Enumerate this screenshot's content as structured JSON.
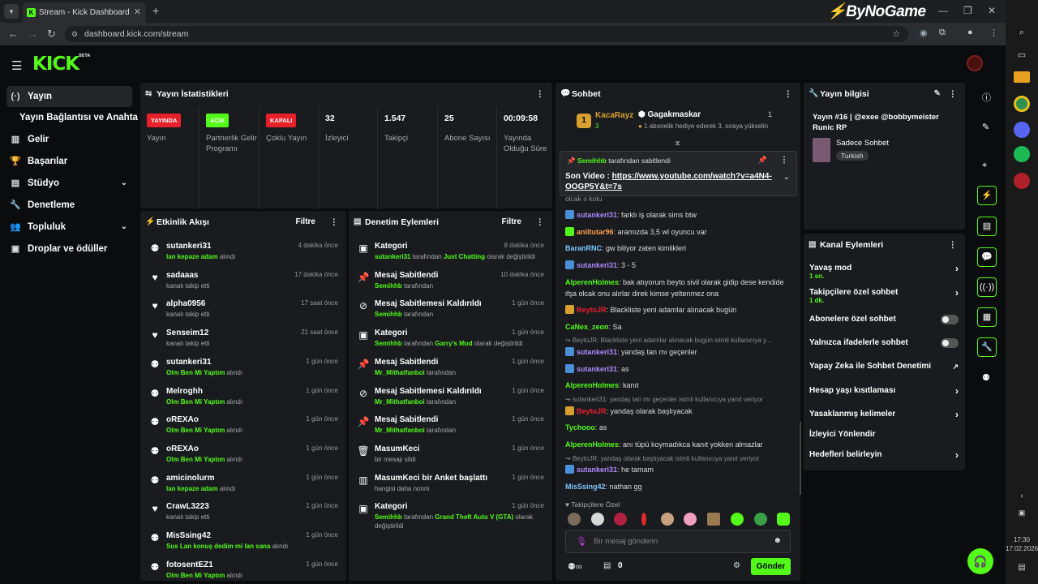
{
  "browser": {
    "tab_title": "Stream - Kick Dashboard",
    "url": "dashboard.kick.com/stream",
    "brand": "ByNoGame"
  },
  "app": {
    "logo": "KICK",
    "logo_beta": "BETA"
  },
  "sidebar": {
    "items": [
      {
        "label": "Yayın",
        "icon": "broadcast-icon"
      },
      {
        "label": "Yayın Bağlantısı ve Anahtarı",
        "icon": ""
      },
      {
        "label": "Gelir",
        "icon": "chart-icon"
      },
      {
        "label": "Başarılar",
        "icon": "trophy-icon"
      },
      {
        "label": "Stüdyo",
        "icon": "studio-icon"
      },
      {
        "label": "Denetleme",
        "icon": "wrench-icon"
      },
      {
        "label": "Topluluk",
        "icon": "community-icon"
      },
      {
        "label": "Droplar ve ödüller",
        "icon": "drops-icon"
      }
    ]
  },
  "stats": {
    "title": "Yayın İstatistikleri",
    "items": [
      {
        "badge": "YAYINDA",
        "label": "Yayın",
        "badge_color": "#e8202a"
      },
      {
        "badge": "AÇIK",
        "label": "Partnerlik Gelir Programı",
        "badge_color": "#53fc18"
      },
      {
        "badge": "KAPALI",
        "label": "Çoklu Yayın",
        "badge_color": "#e8202a"
      },
      {
        "value": "32",
        "label": "İzleyici"
      },
      {
        "value": "1.547",
        "label": "Takipçi"
      },
      {
        "value": "25",
        "label": "Abone Sayısı"
      },
      {
        "value": "00:09:58",
        "label": "Yayında Olduğu Süre"
      }
    ]
  },
  "activity": {
    "title": "Etkinlik Akışı",
    "filter": "Filtre",
    "items": [
      {
        "name": "sutankeri31",
        "hl": "lan kepaze adam",
        "rest": " alındı",
        "time": "4 dakika önce",
        "icon": "reward-icon"
      },
      {
        "name": "sadaaas",
        "hl": "",
        "rest": "kanalı takip etti",
        "time": "17 dakika önce",
        "icon": "heart-icon"
      },
      {
        "name": "alpha0956",
        "hl": "",
        "rest": "kanalı takip etti",
        "time": "17 saat önce",
        "icon": "heart-icon"
      },
      {
        "name": "Senseim12",
        "hl": "",
        "rest": "kanalı takip etti",
        "time": "21 saat önce",
        "icon": "heart-icon"
      },
      {
        "name": "sutankeri31",
        "hl": "Olm Ben Mi Yaptım",
        "rest": " alındı",
        "time": "1 gün önce",
        "icon": "reward-icon"
      },
      {
        "name": "Melroghh",
        "hl": "Olm Ben Mi Yaptım",
        "rest": " alındı",
        "time": "1 gün önce",
        "icon": "reward-icon"
      },
      {
        "name": "oREXAo",
        "hl": "Olm Ben Mi Yaptım",
        "rest": " alındı",
        "time": "1 gün önce",
        "icon": "reward-icon"
      },
      {
        "name": "oREXAo",
        "hl": "Olm Ben Mi Yaptım",
        "rest": " alındı",
        "time": "1 gün önce",
        "icon": "reward-icon"
      },
      {
        "name": "amicinolurm",
        "hl": "lan kepaze adam",
        "rest": " alındı",
        "time": "1 gün önce",
        "icon": "reward-icon"
      },
      {
        "name": "CrawL3223",
        "hl": "",
        "rest": "kanalı takip etti",
        "time": "1 gün önce",
        "icon": "heart-icon"
      },
      {
        "name": "MisSsing42",
        "hl": "Sus Lan konuş dedim mi lan sana",
        "rest": " alındı",
        "time": "1 gün önce",
        "icon": "reward-icon"
      },
      {
        "name": "fotosentEZ1",
        "hl": "Olm Ben Mi Yaptım",
        "rest": " alındı",
        "time": "1 gün önce",
        "icon": "reward-icon"
      }
    ]
  },
  "moderation": {
    "title": "Denetim Eylemleri",
    "filter": "Filtre",
    "items": [
      {
        "name": "Kategori",
        "a": "sutankeri31",
        "mid": " tarafından ",
        "b": "Just Chatting",
        "end": " olarak değiştirildi",
        "time": "8 dakika önce",
        "icon": "category-icon"
      },
      {
        "name": "Mesaj Sabitlendi",
        "a": "Semihhb",
        "mid": " tarafından",
        "b": "",
        "end": "",
        "time": "10 dakika önce",
        "icon": "pin-icon"
      },
      {
        "name": "Mesaj Sabitlemesi Kaldırıldı",
        "a": "Semihhb",
        "mid": " tarafından",
        "b": "",
        "end": "",
        "time": "1 gün önce",
        "icon": "unpin-icon"
      },
      {
        "name": "Kategori",
        "a": "Semihhb",
        "mid": " tarafından ",
        "b": "Garry's Mod",
        "end": " olarak değiştirildi",
        "time": "1 gün önce",
        "icon": "category-icon"
      },
      {
        "name": "Mesaj Sabitlendi",
        "a": "Mr_Mithatfanboi",
        "mid": " tarafından",
        "b": "",
        "end": "",
        "time": "1 gün önce",
        "icon": "pin-icon"
      },
      {
        "name": "Mesaj Sabitlemesi Kaldırıldı",
        "a": "Mr_Mithatfanboi",
        "mid": " tarafından",
        "b": "",
        "end": "",
        "time": "1 gün önce",
        "icon": "unpin-icon"
      },
      {
        "name": "Mesaj Sabitlendi",
        "a": "Mr_Mithatfanboi",
        "mid": " tarafından",
        "b": "",
        "end": "",
        "time": "1 gün önce",
        "icon": "pin-icon"
      },
      {
        "name": "MasumKeci",
        "a": "",
        "mid": "bir mesajı sildi",
        "b": "",
        "end": "",
        "time": "1 gün önce",
        "icon": "trash-icon"
      },
      {
        "name": "MasumKeci bir Anket başlattı",
        "a": "",
        "mid": "hangisi daha nonni",
        "b": "",
        "end": "",
        "time": "1 gün önce",
        "icon": "poll-icon"
      },
      {
        "name": "Kategori",
        "a": "Semihhb",
        "mid": " tarafından ",
        "b": "Grand Theft Auto V (GTA)",
        "end": " olarak",
        "end2": "değiştirildi",
        "time": "1 gün önce",
        "icon": "category-icon"
      }
    ]
  },
  "chat": {
    "title": "Sohbet",
    "gift_user": "KacaRayz",
    "gift_count": "3",
    "gifter": "Gagakmaskar",
    "gifter_count": "1",
    "gifter_text": "1 abonelik hediye ederek 3. sıraya yükselin",
    "pinned_by": "Semihhb",
    "pinned_suffix": " tarafından sabitlendi",
    "pinned_text": "Son Video : ",
    "pinned_link": "https://www.youtube.com/watch?v=a4N4-OOGP5Y&t=7s",
    "partial": "olcak o kotu",
    "messages": [
      {
        "user": "sutankeri31",
        "color": "#b08cff",
        "text": ": farklı iş olarak sims btw",
        "badge": "#4a90d9"
      },
      {
        "user": "aniltutar96",
        "color": "#ff9f4a",
        "text": ": aramızda 3,5 wl oyuncu var",
        "badge": "#53fc18"
      },
      {
        "user": "BaranRNC",
        "color": "#7ec8ff",
        "text": ": gw biliyor zaten kimlikleri",
        "badge": ""
      },
      {
        "user": "sutankeri31",
        "color": "#b08cff",
        "text": ": 3 - 5",
        "badge": "#4a90d9"
      },
      {
        "user": "AlperenHolmes",
        "color": "#53fc18",
        "text": ": bak atıyorum beyto sivil olarak gidip dese kendide",
        "badge": ""
      },
      {
        "user": "",
        "color": "#ddd",
        "text": "ifşa olcak onu alırlar direk kimse yeltenmez ona",
        "badge": ""
      },
      {
        "user": "BeytoJR",
        "color": "#e8202a",
        "text": ": Blackliste yeni adamlar alınacak bugün",
        "badge": "#d9a030"
      },
      {
        "user": "CaNex_zeon",
        "color": "#53fc18",
        "text": ": Sa",
        "badge": ""
      },
      {
        "user": "sutankeri31",
        "color": "#b08cff",
        "text": ": yandaş tan mı geçenler",
        "badge": "#4a90d9"
      },
      {
        "user": "sutankeri31",
        "color": "#b08cff",
        "text": ": as",
        "badge": "#4a90d9"
      },
      {
        "user": "AlperenHolmes",
        "color": "#53fc18",
        "text": ": kanıt",
        "badge": ""
      },
      {
        "user": "BeytoJR",
        "color": "#e8202a",
        "text": ": yandaş olarak başlıyacak",
        "badge": "#d9a030"
      },
      {
        "user": "Tychooo",
        "color": "#53fc18",
        "text": ": as",
        "badge": ""
      },
      {
        "user": "AlperenHolmes",
        "color": "#53fc18",
        "text": ": anı tüpü koymadıkca kanıt yokken almazlar",
        "badge": ""
      },
      {
        "user": "sutankeri31",
        "color": "#b08cff",
        "text": ": he tamam",
        "badge": "#4a90d9"
      },
      {
        "user": "MisSsing42",
        "color": "#7ec8ff",
        "text": ": nathan gg",
        "badge": ""
      }
    ],
    "replies": [
      "BeytoJR: Blackliste yeni adamlar alınacak bugün isimli kullanıcıya y...",
      "sutankeri31: yandaş tan mı geçenler isimli kullanıcıya yanıt veriyor",
      "BeytoJR: yandaş olarak başlıyacak isimli kullanıcıya yanıt veriyor"
    ],
    "followers_only": "Takipçilere Özel",
    "placeholder": "Bir mesaj gönderin",
    "points": "0",
    "send": "Gönder"
  },
  "stream_info": {
    "title": "Yayın bilgisi",
    "stream_title": "Yayın #16 | @exee @bobbymeister Runic RP",
    "category": "Sadece Sohbet",
    "tag": "Turkish"
  },
  "channel_actions": {
    "title": "Kanal Eylemleri",
    "items": [
      {
        "label": "Yavaş mod",
        "sub": "1 sn.",
        "ctrl": "chevron"
      },
      {
        "label": "Takipçilere özel sohbet",
        "sub": "1 dk.",
        "ctrl": "chevron"
      },
      {
        "label": "Abonelere özel sohbet",
        "sub": "",
        "ctrl": "toggle"
      },
      {
        "label": "Yalnızca ifadelerle sohbet",
        "sub": "",
        "ctrl": "toggle"
      },
      {
        "label": "Yapay Zeka ile Sohbet Denetimi",
        "sub": "",
        "ctrl": "external"
      },
      {
        "label": "Hesap yaşı kısıtlaması",
        "sub": "",
        "ctrl": "chevron"
      },
      {
        "label": "Yasaklanmış kelimeler",
        "sub": "",
        "ctrl": "chevron"
      },
      {
        "label": "İzleyici Yönlendir",
        "sub": "",
        "ctrl": ""
      },
      {
        "label": "Hedefleri belirleyin",
        "sub": "",
        "ctrl": "chevron"
      }
    ]
  },
  "clock": {
    "time": "17:30",
    "date": "17.02.2026"
  },
  "colors": {
    "accent": "#53fc18",
    "live": "#e8202a",
    "panel": "#191b1f"
  }
}
